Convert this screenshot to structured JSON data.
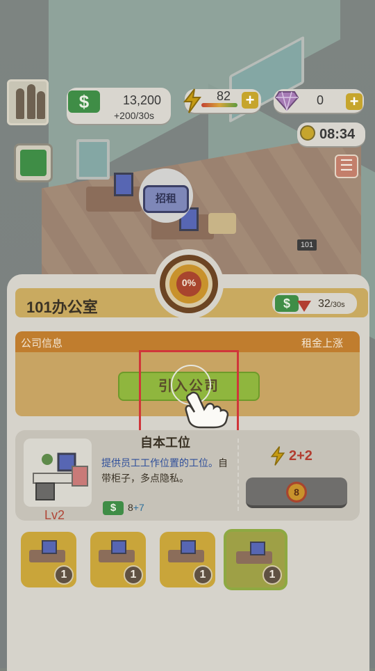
{
  "hud": {
    "cash": "13,200",
    "cash_rate": "+200/30s",
    "energy": "82",
    "gems": "0",
    "time": "08:34",
    "cash_symbol": "$",
    "plus": "+",
    "menu_symbol": "☰"
  },
  "scene": {
    "rent_sign": "招租",
    "room_number": "101"
  },
  "panel": {
    "room_title": "101办公室",
    "occupancy_percent": "0%",
    "income_value": "32",
    "income_unit": "/30s",
    "info_left": "公司信息",
    "info_right": "租金上涨",
    "intro_button": "引入公司"
  },
  "item": {
    "name": "自本工位",
    "desc_highlight": "提供员工工作位置的工位。",
    "desc_rest": "自带柜子，多点隐私。",
    "level": "Lv2",
    "income_base": "8",
    "income_plus": "+7",
    "energy_base": "2",
    "energy_plus": "+2",
    "upgrade_cost": "8"
  },
  "slots": [
    {
      "count": "1",
      "selected": false
    },
    {
      "count": "1",
      "selected": false
    },
    {
      "count": "1",
      "selected": false
    },
    {
      "count": "1",
      "selected": true
    }
  ],
  "colors": {
    "cash_green": "#3f8d46",
    "energy_yellow": "#c59a12",
    "title_bar": "#c9aa60",
    "info_head": "#c07d2e",
    "intro_button": "#8fb63e",
    "tutorial_frame": "#d0353a",
    "level_red": "#b04536"
  }
}
